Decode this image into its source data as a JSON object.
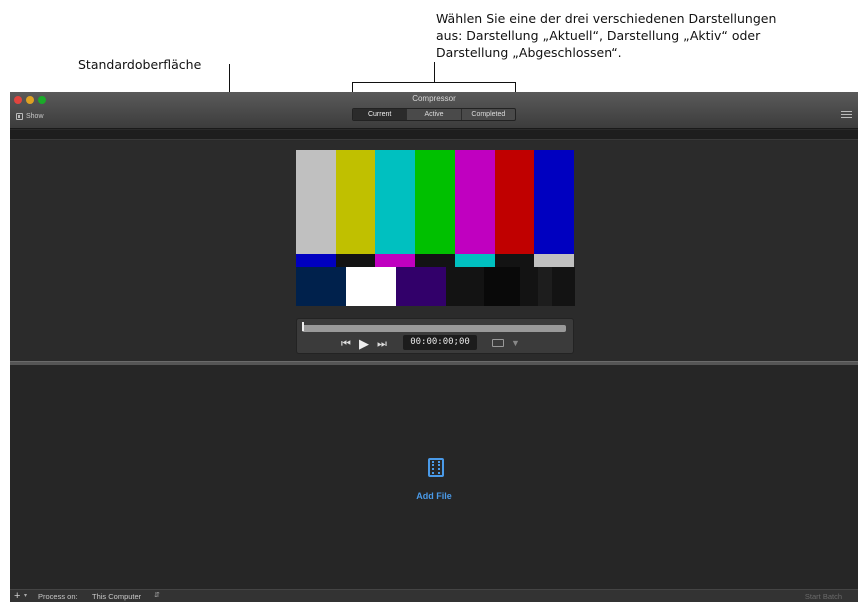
{
  "annotations": {
    "left_label": "Standardoberfläche",
    "right_label_line1": "Wählen Sie eine der drei verschiedenen Darstellungen",
    "right_label_line2": "aus: Darstellung „Aktuell“, Darstellung „Aktiv“ oder",
    "right_label_line3": "Darstellung „Abgeschlossen“."
  },
  "window": {
    "title": "Compressor",
    "show_label": "Show",
    "tabs": [
      {
        "label": "Current",
        "active": true
      },
      {
        "label": "Active",
        "active": false
      },
      {
        "label": "Completed",
        "active": false
      }
    ]
  },
  "viewer": {
    "timecode": "00:00:00;00",
    "icons": [
      "previous-icon",
      "play-icon",
      "next-icon",
      "aspect-icon",
      "marker-icon"
    ],
    "colorbars": {
      "top": [
        "#c0c0c0",
        "#c0c000",
        "#00c0c0",
        "#00c000",
        "#c000c0",
        "#c00000",
        "#0000c0"
      ],
      "middle": [
        "#0000c0",
        "#131313",
        "#c000c0",
        "#131313",
        "#00c0c0",
        "#131313",
        "#c0c0c0"
      ],
      "bottom": [
        "#00214c",
        "#ffffff",
        "#32006a",
        "#131313",
        "#090909",
        "#131313",
        "#1d1d1d",
        "#131313"
      ]
    }
  },
  "batch": {
    "add_file_label": "Add File",
    "icon": "film-icon"
  },
  "bottom_bar": {
    "plus_label": "+",
    "process_label": "Process on:",
    "process_value": "This Computer",
    "start_batch_label": "Start Batch"
  },
  "colors": {
    "accent": "#4a9ae8",
    "window_bg": "#2a2a2a"
  }
}
